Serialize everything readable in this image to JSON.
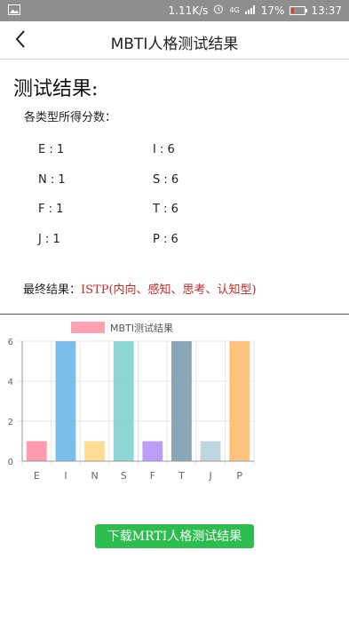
{
  "status_bar": {
    "speed": "1.11K/s",
    "network": "4G",
    "battery": "17%",
    "battery_level": 0.17,
    "time": "13:37"
  },
  "header": {
    "title": "MBTI人格测试结果"
  },
  "content": {
    "heading": "测试结果:",
    "scores_label": "各类型所得分数：",
    "scores": [
      {
        "text": "E : 1"
      },
      {
        "text": "I : 6"
      },
      {
        "text": "N : 1"
      },
      {
        "text": "S : 6"
      },
      {
        "text": "F : 1"
      },
      {
        "text": "T : 6"
      },
      {
        "text": "J : 1"
      },
      {
        "text": "P : 6"
      }
    ],
    "final_label": "最终结果：",
    "final_value": "ISTP(内向、感知、思考、认知型)"
  },
  "chart_data": {
    "type": "bar",
    "legend": "MBTI测试结果",
    "categories": [
      "E",
      "I",
      "N",
      "S",
      "F",
      "T",
      "J",
      "P"
    ],
    "values": [
      1,
      6,
      1,
      6,
      1,
      6,
      1,
      6
    ],
    "ylim": [
      0,
      6
    ],
    "yticks": [
      "0",
      "2",
      "4",
      "6"
    ],
    "colors": [
      "#ff8fa6",
      "#6bb7ea",
      "#ffd88a",
      "#7fd1cf",
      "#b493f5",
      "#7d9caf",
      "#b9d1dc",
      "#ffbd70"
    ],
    "grid": true,
    "legend_position": "top"
  },
  "download_button": {
    "label": "下载MRTI人格测试结果"
  }
}
